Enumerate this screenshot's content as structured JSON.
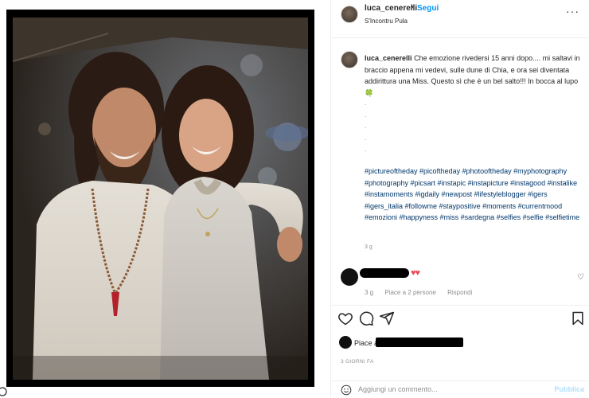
{
  "header": {
    "username": "luca_cenerelli",
    "separator": "•",
    "follow_label": "Segui",
    "location": "S'Incontru Pula",
    "more_label": "···"
  },
  "caption": {
    "username": "luca_cenerelli",
    "text": "Che emozione rivedersi 15 anni dopo.... mi saltavi in braccio appena mi vedevi, sulle dune di Chia, e ora sei diventata addirittura una Miss. Questo sì che è un bel salto!!! In bocca al lupo",
    "emoji": "🍀",
    "dots": [
      ".",
      ".",
      ".",
      ".",
      "."
    ],
    "hashtags": "#pictureoftheday #picoftheday #photooftheday #myphotography #photography #picsart #instapic #instapicture #instagood #instalike #instamoments #igdaily #newpost #lifestyleblogger #igers #igers_italia #followme #staypositive #moments #currentmood #emozioni #happyness #miss #sardegna #selfies #selfie #selfietime",
    "time": "3 g"
  },
  "comment": {
    "hearts": "♥♥",
    "time": "3 g",
    "likes": "Piace a 2 persone",
    "reply": "Rispondi"
  },
  "actions": {
    "like_icon": "heart-icon",
    "comment_icon": "comment-icon",
    "share_icon": "share-icon",
    "save_icon": "bookmark-icon"
  },
  "likes": {
    "prefix": "Piace a"
  },
  "post_date": "3 GIORNI FA",
  "add_comment": {
    "placeholder": "Aggiungi un commento...",
    "publish_label": "Pubblica"
  },
  "colors": {
    "link": "#00376b",
    "follow": "#0095f6",
    "heart": "#ed4956",
    "publish_disabled": "#b2dffc"
  }
}
